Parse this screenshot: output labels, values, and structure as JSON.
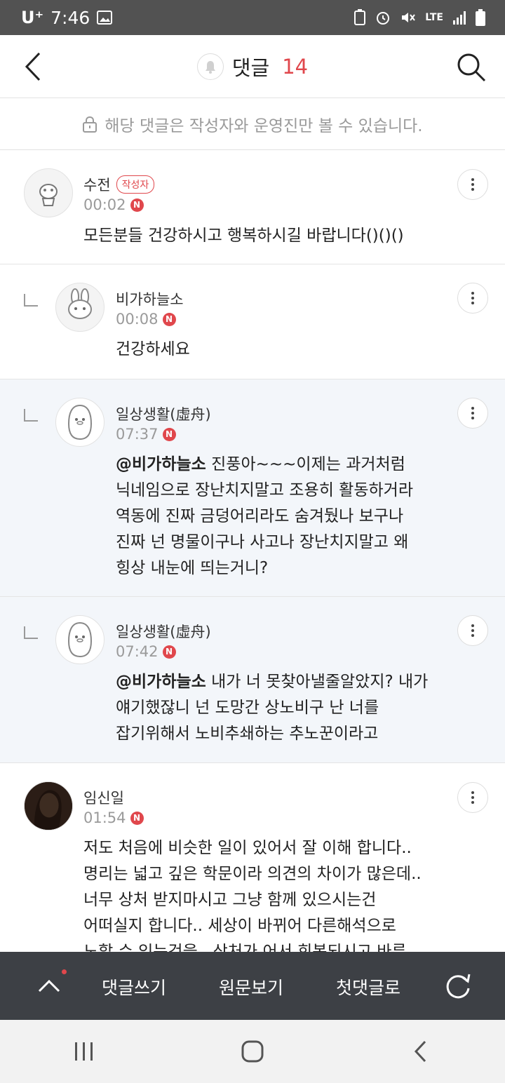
{
  "status_bar": {
    "carrier": "U⁺",
    "time": "7:46",
    "network": "LTE"
  },
  "header": {
    "title": "댓글",
    "count": "14"
  },
  "notice": {
    "text": "해당 댓글은 작성자와 운영진만 볼 수 있습니다."
  },
  "comments": [
    {
      "name": "수전",
      "badge": "작성자",
      "time": "00:02",
      "new": "N",
      "text": "모든분들 건강하시고 행복하시길 바랍니다()()()"
    },
    {
      "name": "비가하늘소",
      "time": "00:08",
      "new": "N",
      "text": "건강하세요"
    },
    {
      "name": "일상생활(虛舟)",
      "time": "07:37",
      "new": "N",
      "mention": "@비가하늘소",
      "text": " 진풍아~~~이제는 과거처럼\n닉네임으로 장난치지말고 조용히 활동하거라\n역동에 진짜 금덩어리라도 숨겨뒀나 보구나\n진짜 넌 명물이구나 사고나 장난치지말고 왜\n힝상 내눈에 띄는거니?"
    },
    {
      "name": "일상생활(虛舟)",
      "time": "07:42",
      "new": "N",
      "mention": "@비가하늘소",
      "text": " 내가 너 못찾아낼줄알았지? 내가\n얘기했잖니 넌 도망간 상노비구 난 너를\n잡기위해서 노비추쇄하는 추노꾼이라고"
    },
    {
      "name": "임신일",
      "time": "01:54",
      "new": "N",
      "text": "저도 처음에 비슷한 일이 있어서 잘 이해 합니다..\n명리는 넓고 깊은 학문이라 의견의 차이가 많은데..\n너무 상처 받지마시고 그냥 함께 있으시는건\n어떠실지 합니다.. 세상이 바뀌어 다른해석으로\n노할 수 있는것을.. 상처가 어서 회복되시고 바른"
    }
  ],
  "bottom_bar": {
    "write": "댓글쓰기",
    "original": "원문보기",
    "first": "첫댓글로"
  },
  "colors": {
    "accent": "#e0474c",
    "bottom_bar": "#3d4045",
    "highlight_bg": "#f3f6fa"
  }
}
